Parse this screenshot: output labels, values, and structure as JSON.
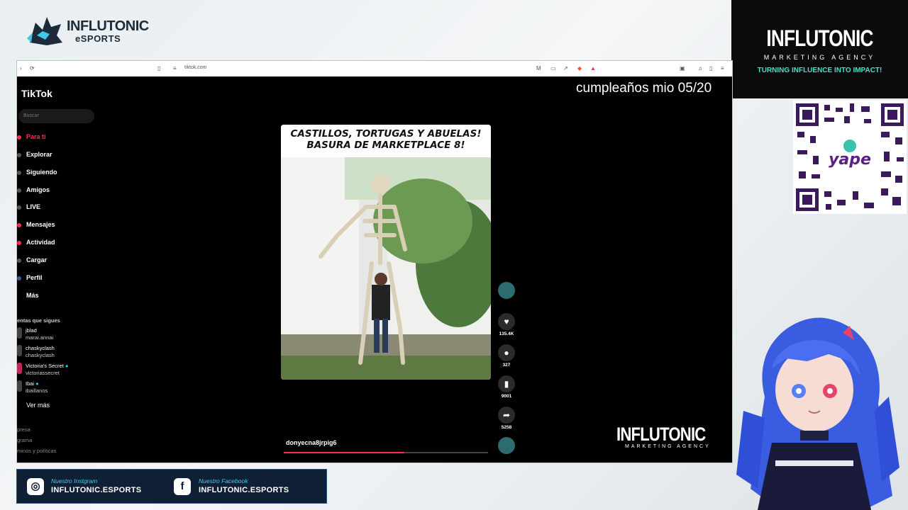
{
  "brand": {
    "name": "INFLUTONIC",
    "sub": "eSPORTS"
  },
  "agency": {
    "name": "INFLUTONIC",
    "sub": "MARKETING AGENCY",
    "tagline": "TURNING INFLUENCE INTO IMPACT!"
  },
  "qr": {
    "label": "S/ yape",
    "icon": "qr-code"
  },
  "browser": {
    "url": "tiktok.com"
  },
  "tiktok": {
    "logo": "TikTok",
    "search_placeholder": "Buscar",
    "nav": [
      "Para ti",
      "Explorar",
      "Siguiendo",
      "Amigos",
      "LIVE",
      "Mensajes",
      "Actividad",
      "Cargar",
      "Perfil",
      "Más"
    ],
    "following_title": "entas que sigues",
    "accounts": [
      {
        "name": "jblad",
        "user": "marai.annai"
      },
      {
        "name": "chaskyclash",
        "user": "chaskyclash"
      },
      {
        "name": "Victoria's Secret",
        "user": "victoriassecret"
      },
      {
        "name": "Ibai",
        "user": "ibaillanos"
      }
    ],
    "see_more": "Ver más",
    "footer": [
      "presa",
      "grama",
      "minos y políticas"
    ],
    "caption_line1": "CASTILLOS, TORTUGAS Y ABUELAS!",
    "caption_line2": "BASURA DE MARKETPLACE 8!",
    "creator": "donyecna8jrpig6",
    "progress": 0.59,
    "likes": "135.4K",
    "comments": "327",
    "saves": "9001",
    "shares": "5258"
  },
  "overlay": {
    "text": "cumpleaños mio 05/20"
  },
  "watermark": {
    "name": "INFLUTONIC",
    "sub": "MARKETING AGENCY"
  },
  "social": {
    "ig_label": "Nuestro Instgram",
    "ig_handle": "INFLUTONIC.ESPORTS",
    "fb_label": "Nuestro Facebook",
    "fb_handle": "INFLUTONIC.ESPORTS"
  }
}
